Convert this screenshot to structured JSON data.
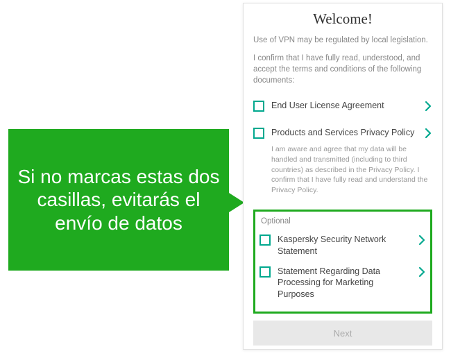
{
  "callout": {
    "text": "Si no marcas estas dos casillas, evitarás el envío de datos"
  },
  "panel": {
    "title": "Welcome!",
    "subtitle": "Use of VPN may be regulated by local legislation.",
    "intro": "I confirm that I have fully read, understood, and accept the terms and conditions of the following documents:",
    "required_docs": [
      {
        "label": "End User License Agreement",
        "note": ""
      },
      {
        "label": "Products and Services Privacy Policy",
        "note": "I am aware and agree that my data will be handled and transmitted (including to third countries) as described in the Privacy Policy. I confirm that I have fully read and understand the Privacy Policy."
      }
    ],
    "optional_heading": "Optional",
    "optional_docs": [
      {
        "label": "Kaspersky Security Network Statement"
      },
      {
        "label": "Statement Regarding Data Processing for Marketing Purposes"
      }
    ],
    "next_label": "Next"
  },
  "colors": {
    "accent": "#00a88e",
    "highlight": "#1faa1f"
  }
}
